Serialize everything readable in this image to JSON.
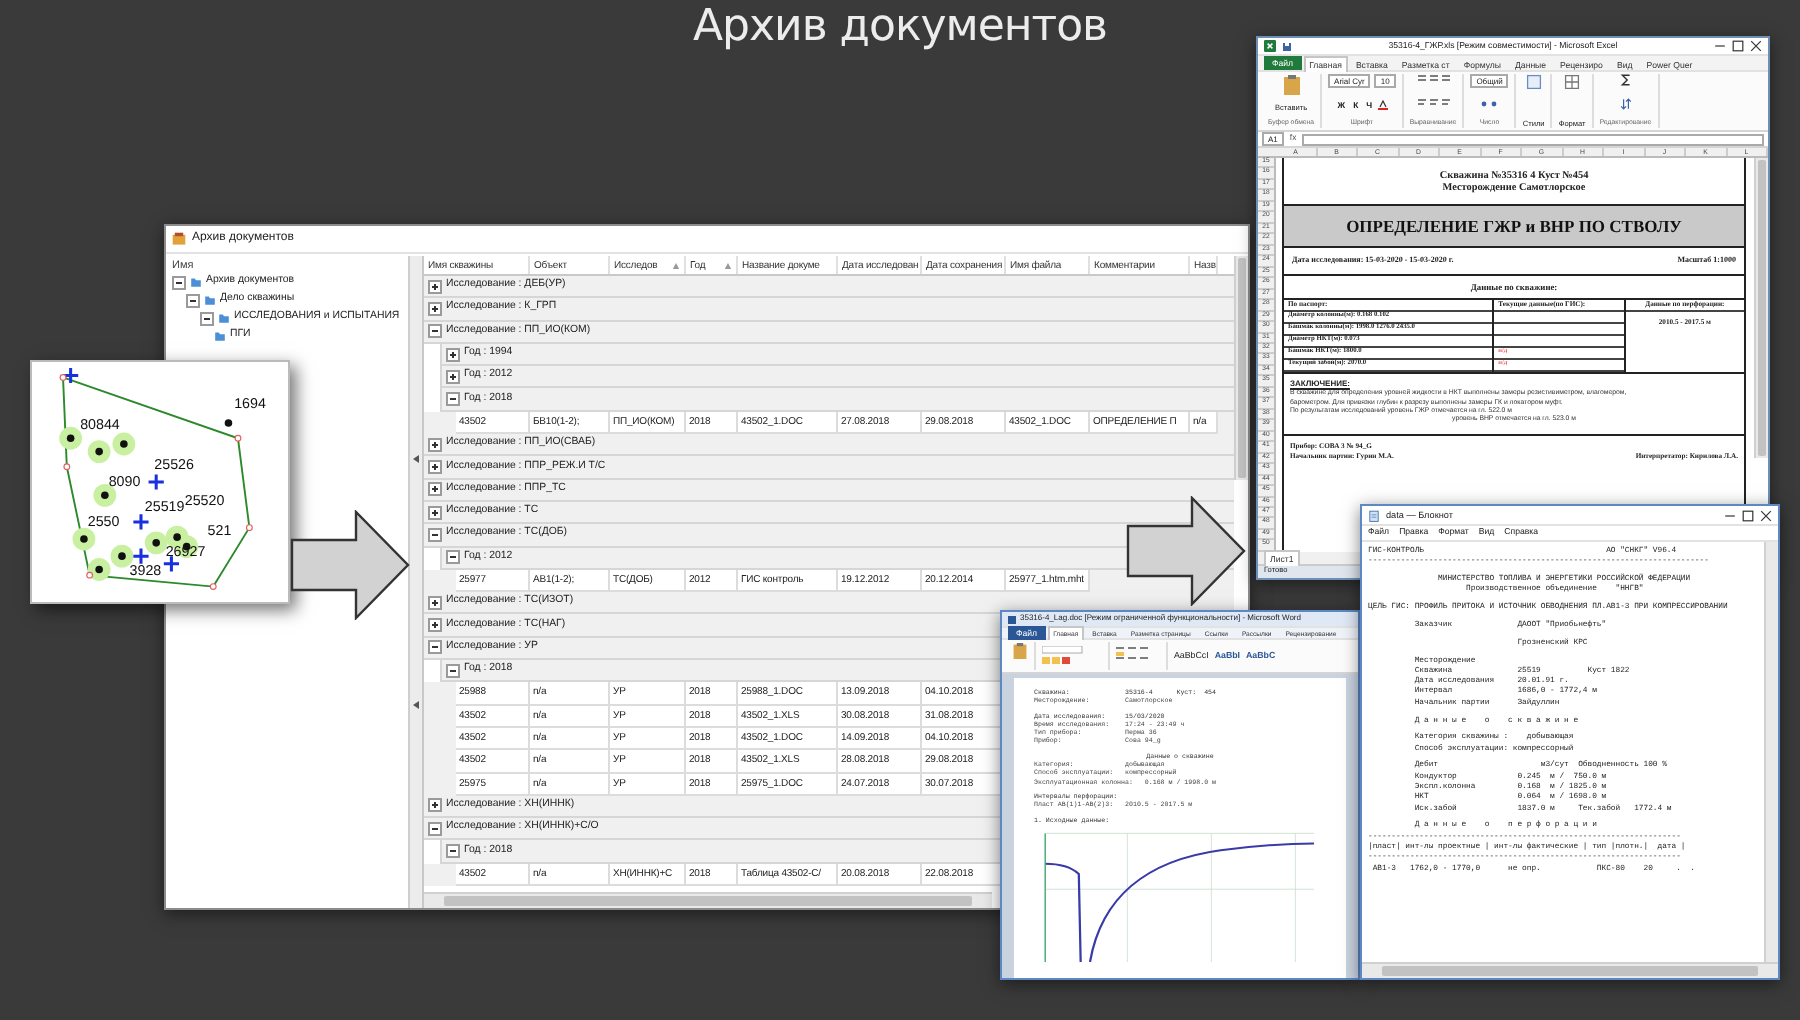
{
  "slide_title": "Архив документов",
  "archive_window": {
    "title": "Архив документов",
    "tree": {
      "header": "Имя",
      "nodes": [
        {
          "label": "Архив документов",
          "expanded": true,
          "children": [
            {
              "label": "Дело скважины",
              "expanded": true,
              "children": [
                {
                  "label": "ИССЛЕДОВАНИЯ и ИСПЫТАНИЯ",
                  "expanded": true,
                  "children": [
                    {
                      "label": "ПГИ"
                    }
                  ]
                }
              ]
            }
          ]
        }
      ]
    },
    "grid": {
      "columns": [
        {
          "label": "Имя скважины",
          "sorted": false
        },
        {
          "label": "Объект",
          "sorted": false
        },
        {
          "label": "Исследов",
          "sorted": true
        },
        {
          "label": "Год",
          "sorted": true
        },
        {
          "label": "Название докуме",
          "sorted": false
        },
        {
          "label": "Дата исследован",
          "sorted": false
        },
        {
          "label": "Дата сохранения",
          "sorted": false
        },
        {
          "label": "Имя файла",
          "sorted": false
        },
        {
          "label": "Комментарии",
          "sorted": false
        },
        {
          "label": "Назв",
          "sorted": false
        }
      ],
      "groups": [
        {
          "label": "Исследование : ДЕБ(УР)",
          "expanded": false
        },
        {
          "label": "Исследование : К_ГРП",
          "expanded": false
        },
        {
          "label": "Исследование : ПП_ИО(КОМ)",
          "expanded": true,
          "children": [
            {
              "label": "Год : 1994",
              "expanded": false
            },
            {
              "label": "Год : 2012",
              "expanded": false
            },
            {
              "label": "Год : 2018",
              "expanded": true,
              "children": [
                {
                  "cells": [
                    "43502",
                    "БВ10(1-2);",
                    "ПП_ИО(КОМ)",
                    "2018",
                    "43502_1.DOC",
                    "27.08.2018",
                    "29.08.2018",
                    "43502_1.DOC",
                    "ОПРЕДЕЛЕНИЕ П",
                    "n/a"
                  ]
                }
              ]
            }
          ]
        },
        {
          "label": "Исследование : ПП_ИО(СВАБ)",
          "expanded": false
        },
        {
          "label": "Исследование : ППР_РЕЖ.И Т/С",
          "expanded": false
        },
        {
          "label": "Исследование : ППР_ТС",
          "expanded": false
        },
        {
          "label": "Исследование : ТС",
          "expanded": false
        },
        {
          "label": "Исследование : ТС(ДОБ)",
          "expanded": true,
          "children": [
            {
              "label": "Год : 2012",
              "expanded": true,
              "children": [
                {
                  "cells": [
                    "25977",
                    "АВ1(1-2);",
                    "ТС(ДОБ)",
                    "2012",
                    "ГИС контроль",
                    "19.12.2012",
                    "20.12.2014",
                    "25977_1.htm.mht"
                  ]
                }
              ]
            }
          ]
        },
        {
          "label": "Исследование : ТС(ИЗОТ)",
          "expanded": false
        },
        {
          "label": "Исследование : ТС(НАГ)",
          "expanded": false
        },
        {
          "label": "Исследование : УР",
          "expanded": true,
          "children": [
            {
              "label": "Год : 2018",
              "expanded": true,
              "children": [
                {
                  "cells": [
                    "25988",
                    "n/a",
                    "УР",
                    "2018",
                    "25988_1.DOC",
                    "13.09.2018",
                    "04.10.2018"
                  ]
                },
                {
                  "cells": [
                    "43502",
                    "n/a",
                    "УР",
                    "2018",
                    "43502_1.XLS",
                    "30.08.2018",
                    "31.08.2018"
                  ]
                },
                {
                  "cells": [
                    "43502",
                    "n/a",
                    "УР",
                    "2018",
                    "43502_1.DOC",
                    "14.09.2018",
                    "04.10.2018"
                  ]
                },
                {
                  "cells": [
                    "43502",
                    "n/a",
                    "УР",
                    "2018",
                    "43502_1.XLS",
                    "28.08.2018",
                    "29.08.2018"
                  ]
                },
                {
                  "cells": [
                    "25975",
                    "n/a",
                    "УР",
                    "2018",
                    "25975_1.DOC",
                    "24.07.2018",
                    "30.07.2018"
                  ]
                }
              ]
            }
          ]
        },
        {
          "label": "Исследование : ХН(ИННК)",
          "expanded": false
        },
        {
          "label": "Исследование : ХН(ИННК)+С/О",
          "expanded": true,
          "children": [
            {
              "label": "Год : 2018",
              "expanded": true,
              "children": [
                {
                  "cells": [
                    "43502",
                    "n/a",
                    "ХН(ИННК)+С",
                    "2018",
                    "Таблица 43502-С/",
                    "20.08.2018",
                    "22.08.2018"
                  ]
                }
              ]
            }
          ]
        }
      ]
    }
  },
  "map": {
    "labels": [
      "1694",
      "80844",
      "25526",
      "8090",
      "25519",
      "25520",
      "2550",
      "521",
      "26927",
      "3928"
    ]
  },
  "excel_window": {
    "title": "35316-4_ГЖР.xls [Режим совместимости] - Microsoft Excel",
    "file_tab": "Файл",
    "ribbon_tabs": [
      {
        "label": "Главная",
        "selected": true
      },
      {
        "label": "Вставка",
        "selected": false
      },
      {
        "label": "Разметка ст",
        "selected": false
      },
      {
        "label": "Формулы",
        "selected": false
      },
      {
        "label": "Данные",
        "selected": false
      },
      {
        "label": "Рецензиро",
        "selected": false
      },
      {
        "label": "Вид",
        "selected": false
      },
      {
        "label": "Power Quer",
        "selected": false
      }
    ],
    "paste_label": "Вставить",
    "font_name": "Arial Cyr",
    "font_size": "10",
    "style_buttons": [
      "Ж",
      "К",
      "Ч"
    ],
    "number_format": "Общий",
    "styles_label": "Стили",
    "format_label": "Формат",
    "ribbon_groups": [
      "Буфер обмена",
      "Шрифт",
      "Выравнивание",
      "Число",
      "Редактирование"
    ],
    "name_box": "A1",
    "formula_label": "fx",
    "column_letters": [
      "A",
      "B",
      "C",
      "D",
      "E",
      "F",
      "G",
      "H",
      "I",
      "J",
      "K",
      "L"
    ],
    "row_numbers": [
      "15",
      "16",
      "17",
      "18",
      "19",
      "20",
      "21",
      "22",
      "23",
      "24",
      "25",
      "26",
      "27",
      "28",
      "29",
      "30",
      "31",
      "32",
      "33",
      "34",
      "35",
      "36",
      "37",
      "38",
      "39",
      "40",
      "41",
      "42",
      "43",
      "44",
      "45",
      "46",
      "47",
      "48",
      "49",
      "50"
    ],
    "sheet": {
      "heading": [
        "Скважина №35316 4 Куст №454",
        "Месторождение Самотлорское"
      ],
      "banner": "ОПРЕДЕЛЕНИЕ ГЖР и ВНР ПО СТВОЛУ",
      "date": "Дата исследования: 15-03-2020 - 15-03-2020 г.",
      "scale": "Масштаб 1:1000",
      "section": "Данные по скважине:",
      "passport_header": "По паспорт:",
      "current_header": "Текущие данные(по ГИС):",
      "perforation_header": "Данные по перфорации:",
      "passport_rows": [
        {
          "label": "Диаметр колонны(м): 0.168  0.102"
        },
        {
          "label": "Башмак колонны(м): 1998.0  1276.0  2435.0"
        },
        {
          "label": "Диаметр НКТ(м): 0.073"
        },
        {
          "label": "Башмак НКТ(м): 1800.0",
          "current": "н/д"
        },
        {
          "label": "Текущий забой(м): 2070.0",
          "current": "н/д"
        }
      ],
      "perforation": "2010.5 - 2017.5 м",
      "conclusion_title": "ЗАКЛЮЧЕНИЕ:",
      "conclusion": [
        "В скважине для определения уровней жидкости в НКТ выполнены замеры резистивиметром, влагомером,",
        "барометром. Для привязки глубин к разрезу выполнены замеры ГК и локатором муфт.",
        "По результатам исследований уровень ГЖР отмечается на гл. 522.0 м",
        "уровень ВНР отмечается на гл. 523.0 м"
      ],
      "device": "Прибор: СОВА 3 № 94_G",
      "chief": "Начальник партии: Гурин М.А.",
      "interpreter": "Интерпретатор: Кирилова Л.А."
    },
    "sheet_tab": "Лист1",
    "status": "Готово"
  },
  "notepad_window": {
    "title": "data — Блокнот",
    "menu": [
      "Файл",
      "Правка",
      "Формат",
      "Вид",
      "Справка"
    ],
    "text_blocks": [
      [
        "ГИС-КОНТРОЛЬ                                       АО \"СНКГ\" V96.4",
        "-------------------------------------------------------------------------"
      ],
      [
        "               МИНИСТЕРСТВО ТОПЛИВА И ЭНЕРГЕТИКИ РОССИЙСКОЙ ФЕДЕРАЦИИ",
        "                     Производственное объединение    \"ННГВ\""
      ],
      [
        "ЦЕЛЬ ГИС: ПРОФИЛЬ ПРИТОКА И ИСТОЧНИК ОБВОДНЕНИЯ ПЛ.АВ1-3 ПРИ КОМПРЕССИРОВАНИИ"
      ],
      [
        "          Заказчик              ДАООТ \"Приобьнефть\""
      ],
      [
        "                                Грозненский КРС"
      ],
      [
        "          Месторождение",
        "          Скважина              25519          Куст 1822",
        "          Дата исследования     20.01.91 г.",
        "          Интервал              1686,0 - 1772,4 м",
        "          Начальник партии      Зайдуллин"
      ],
      [
        "          Д а н н ы е    о    с к в а ж и н е"
      ],
      [
        "          Категория скважины :    добывающая",
        "          Способ эксплуатации: компрессорный"
      ],
      [
        "          Дебит                      м3/сут  Обводненность 100 %",
        "          Кондуктор             0.245  м /  750.0 м",
        "          Экспл.колонна         0.168  м / 1825.0 м",
        "          НКТ                   0.064  м / 1698.0 м",
        "          Иск.забой             1837.0 м     Тек.забой   1772.4 м"
      ],
      [
        "          Д а н н ы е    о    п е р ф о р а ц и и",
        "-------------------------------------------------------------------",
        "|пласт| инт-лы проектные | инт-лы фактические | тип |плотн.|  дата |",
        "-------------------------------------------------------------------",
        " АВ1-3   1762,0 - 1770,0      не опр.            ПКС-80    20     .  ."
      ]
    ]
  },
  "word_window": {
    "title": "35316-4_Lag.doc [Режим ограниченной функциональности] - Microsoft Word",
    "file_tab": "Файл",
    "ribbon_tabs": [
      {
        "label": "Главная",
        "selected": true
      },
      {
        "label": "Вставка",
        "selected": false
      },
      {
        "label": "Разметка страницы",
        "selected": false
      },
      {
        "label": "Ссылки",
        "selected": false
      },
      {
        "label": "Рассылки",
        "selected": false
      },
      {
        "label": "Рецензирование",
        "selected": false
      }
    ],
    "style_samples": [
      "AaBbCcI",
      "AaBbI",
      "AaBbC"
    ],
    "page_blocks": [
      [
        "Скважина:              35316-4      Куст:  454",
        "Месторождение:         Самотлорское"
      ],
      [
        "Дата исследования:     15/03/2020",
        "Время исследования:    17:24 - 23:49 ч",
        "Тип прибора:           Перма 36",
        "Прибор:                Сова 94_g"
      ],
      [
        "Данные о скважине",
        "Категория:             добывающая",
        "Способ эксплуатации:   компрессорный",
        "Эксплуатационная колонна:   0.168 м / 1998.0 м"
      ],
      [
        "Интервалы перфорации:",
        "Пласт АВ(1)1-АВ(2)3:   2010.5 - 2017.5 м"
      ],
      [
        "1. Исходные данные:"
      ]
    ]
  }
}
